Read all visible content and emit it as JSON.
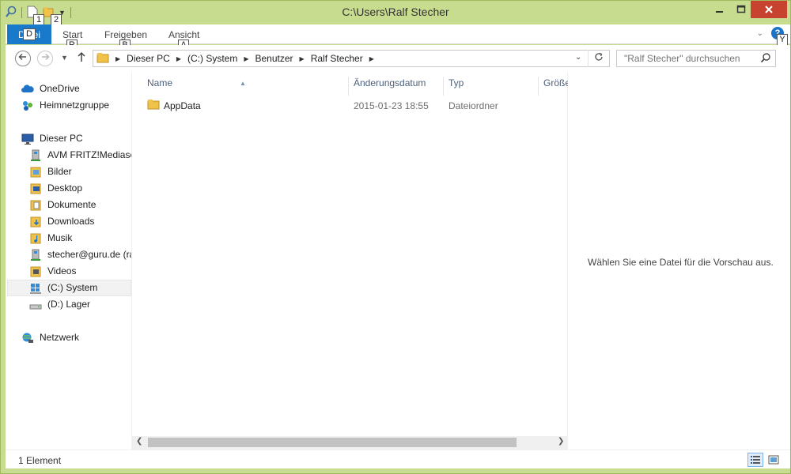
{
  "window": {
    "title": "C:\\Users\\Ralf Stecher"
  },
  "keytips": {
    "qat1": "1",
    "qat2": "2",
    "datei": "D",
    "start": "R",
    "freigeben": "B",
    "ansicht": "A",
    "help": "Y"
  },
  "ribbon": {
    "tabs": [
      {
        "label": "Datei"
      },
      {
        "label": "Start"
      },
      {
        "label": "Freigeben"
      },
      {
        "label": "Ansicht"
      }
    ],
    "help_label": "?"
  },
  "address": {
    "breadcrumbs": [
      "Dieser PC",
      "(C:) System",
      "Benutzer",
      "Ralf Stecher"
    ]
  },
  "search": {
    "placeholder": "\"Ralf Stecher\" durchsuchen"
  },
  "navpane": {
    "items": [
      {
        "label": "OneDrive",
        "icon": "cloud-icon"
      },
      {
        "label": "Heimnetzgruppe",
        "icon": "homegroup-icon"
      },
      {
        "label": "Dieser PC",
        "icon": "computer-icon"
      },
      {
        "label": "AVM FRITZ!Mediaserver",
        "icon": "network-drive-icon"
      },
      {
        "label": "Bilder",
        "icon": "pictures-folder-icon"
      },
      {
        "label": "Desktop",
        "icon": "desktop-folder-icon"
      },
      {
        "label": "Dokumente",
        "icon": "documents-folder-icon"
      },
      {
        "label": "Downloads",
        "icon": "downloads-folder-icon"
      },
      {
        "label": "Musik",
        "icon": "music-folder-icon"
      },
      {
        "label": "stecher@guru.de (ra",
        "icon": "network-drive-icon"
      },
      {
        "label": "Videos",
        "icon": "videos-folder-icon"
      },
      {
        "label": "(C:) System",
        "icon": "system-drive-icon"
      },
      {
        "label": "(D:) Lager",
        "icon": "drive-icon"
      },
      {
        "label": "Netzwerk",
        "icon": "network-icon"
      }
    ]
  },
  "filelist": {
    "columns": [
      "Name",
      "Änderungsdatum",
      "Typ",
      "Größe"
    ],
    "rows": [
      {
        "name": "AppData",
        "date": "2015-01-23 18:55",
        "type": "Dateiordner",
        "size": ""
      }
    ]
  },
  "preview": {
    "message": "Wählen Sie eine Datei für die Vorschau aus."
  },
  "statusbar": {
    "count": "1 Element"
  },
  "colors": {
    "accent": "#1979ca",
    "frame": "#c7dc8f",
    "close": "#c7432f"
  }
}
